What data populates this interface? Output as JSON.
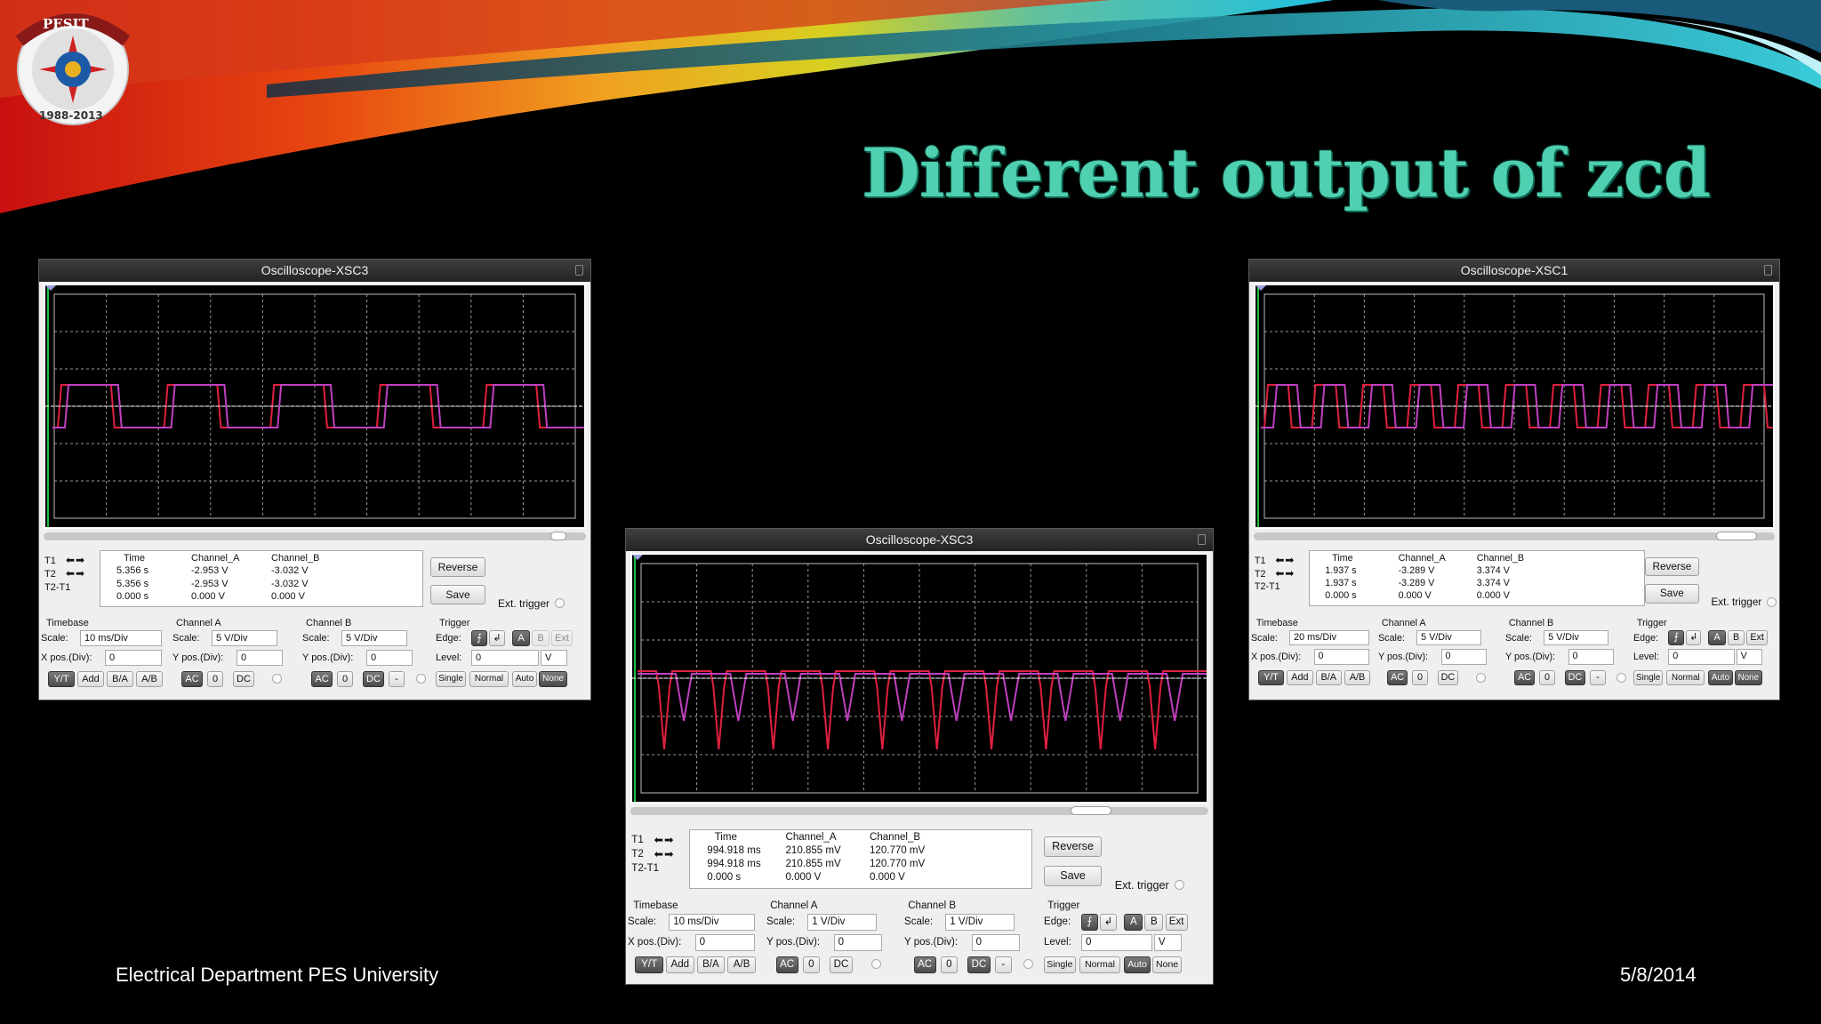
{
  "slide": {
    "title": "Different output of zcd",
    "footer_left": "Electrical Department PES University",
    "footer_right": "5/8/2014",
    "logo": {
      "top_text": "PESIT",
      "bottom_text": "1988-2013"
    },
    "colors": {
      "title": "#4fd0b0",
      "channel_a": "#e02040",
      "channel_b": "#c040c0",
      "grid": "#9a9a9a",
      "background": "#000000"
    }
  },
  "oscilloscopes": [
    {
      "title": "Oscilloscope-XSC3",
      "waveform": "square",
      "readout": {
        "headers": [
          "Time",
          "Channel_A",
          "Channel_B"
        ],
        "rows": [
          {
            "label": "T1",
            "time": "5.356 s",
            "a": "-2.953 V",
            "b": "-3.032 V"
          },
          {
            "label": "T2",
            "time": "5.356 s",
            "a": "-2.953 V",
            "b": "-3.032 V"
          },
          {
            "label": "T2-T1",
            "time": "0.000 s",
            "a": "0.000 V",
            "b": "0.000 V"
          }
        ]
      },
      "buttons": {
        "reverse": "Reverse",
        "save": "Save",
        "ext_trigger": "Ext. trigger"
      },
      "timebase": {
        "label": "Timebase",
        "scale_label": "Scale:",
        "scale": "10 ms/Div",
        "pos_label": "X pos.(Div):",
        "pos": "0",
        "modes": [
          "Y/T",
          "Add",
          "B/A",
          "A/B"
        ]
      },
      "channel_a": {
        "label": "Channel A",
        "scale_label": "Scale:",
        "scale": "5 V/Div",
        "pos_label": "Y pos.(Div):",
        "pos": "0",
        "coupling": [
          "AC",
          "0",
          "DC"
        ]
      },
      "channel_b": {
        "label": "Channel B",
        "scale_label": "Scale:",
        "scale": "5 V/Div",
        "pos_label": "Y pos.(Div):",
        "pos": "0",
        "coupling": [
          "AC",
          "0",
          "DC",
          "-"
        ]
      },
      "trigger": {
        "label": "Trigger",
        "edge_label": "Edge:",
        "edge_buttons": [
          "A",
          "B",
          "Ext"
        ],
        "level_label": "Level:",
        "level": "0",
        "level_unit": "V",
        "modes": [
          "Single",
          "Normal",
          "Auto",
          "None"
        ]
      }
    },
    {
      "title": "Oscilloscope-XSC3",
      "waveform": "pulse",
      "readout": {
        "headers": [
          "Time",
          "Channel_A",
          "Channel_B"
        ],
        "rows": [
          {
            "label": "T1",
            "time": "994.918 ms",
            "a": "210.855 mV",
            "b": "120.770 mV"
          },
          {
            "label": "T2",
            "time": "994.918 ms",
            "a": "210.855 mV",
            "b": "120.770 mV"
          },
          {
            "label": "T2-T1",
            "time": "0.000 s",
            "a": "0.000 V",
            "b": "0.000 V"
          }
        ]
      },
      "buttons": {
        "reverse": "Reverse",
        "save": "Save",
        "ext_trigger": "Ext. trigger"
      },
      "timebase": {
        "label": "Timebase",
        "scale_label": "Scale:",
        "scale": "10 ms/Div",
        "pos_label": "X pos.(Div):",
        "pos": "0",
        "modes": [
          "Y/T",
          "Add",
          "B/A",
          "A/B"
        ]
      },
      "channel_a": {
        "label": "Channel A",
        "scale_label": "Scale:",
        "scale": "1 V/Div",
        "pos_label": "Y pos.(Div):",
        "pos": "0",
        "coupling": [
          "AC",
          "0",
          "DC"
        ]
      },
      "channel_b": {
        "label": "Channel B",
        "scale_label": "Scale:",
        "scale": "1 V/Div",
        "pos_label": "Y pos.(Div):",
        "pos": "0",
        "coupling": [
          "AC",
          "0",
          "DC",
          "-"
        ]
      },
      "trigger": {
        "label": "Trigger",
        "edge_label": "Edge:",
        "edge_buttons": [
          "A",
          "B",
          "Ext"
        ],
        "level_label": "Level:",
        "level": "0",
        "level_unit": "V",
        "modes": [
          "Single",
          "Normal",
          "Auto",
          "None"
        ]
      }
    },
    {
      "title": "Oscilloscope-XSC1",
      "waveform": "square-fast",
      "readout": {
        "headers": [
          "Time",
          "Channel_A",
          "Channel_B"
        ],
        "rows": [
          {
            "label": "T1",
            "time": "1.937 s",
            "a": "-3.289 V",
            "b": "3.374 V"
          },
          {
            "label": "T2",
            "time": "1.937 s",
            "a": "-3.289 V",
            "b": "3.374 V"
          },
          {
            "label": "T2-T1",
            "time": "0.000 s",
            "a": "0.000 V",
            "b": "0.000 V"
          }
        ]
      },
      "buttons": {
        "reverse": "Reverse",
        "save": "Save",
        "ext_trigger": "Ext. trigger"
      },
      "timebase": {
        "label": "Timebase",
        "scale_label": "Scale:",
        "scale": "20 ms/Div",
        "pos_label": "X pos.(Div):",
        "pos": "0",
        "modes": [
          "Y/T",
          "Add",
          "B/A",
          "A/B"
        ]
      },
      "channel_a": {
        "label": "Channel A",
        "scale_label": "Scale:",
        "scale": "5 V/Div",
        "pos_label": "Y pos.(Div):",
        "pos": "0",
        "coupling": [
          "AC",
          "0",
          "DC"
        ]
      },
      "channel_b": {
        "label": "Channel B",
        "scale_label": "Scale:",
        "scale": "5 V/Div",
        "pos_label": "Y pos.(Div):",
        "pos": "0",
        "coupling": [
          "AC",
          "0",
          "DC",
          "-"
        ]
      },
      "trigger": {
        "label": "Trigger",
        "edge_label": "Edge:",
        "edge_buttons": [
          "A",
          "B",
          "Ext"
        ],
        "level_label": "Level:",
        "level": "0",
        "level_unit": "V",
        "modes": [
          "Single",
          "Normal",
          "Auto",
          "None"
        ]
      }
    }
  ]
}
